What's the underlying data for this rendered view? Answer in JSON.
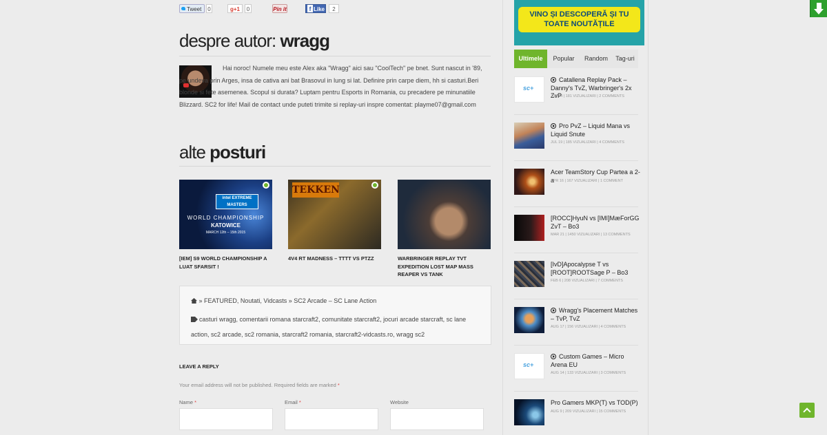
{
  "share": {
    "tweet_label": "Tweet",
    "tweet_count": "0",
    "gplus_label": "g+1",
    "gplus_count": "0",
    "pinit_label": "Pin it",
    "like_label": "Like",
    "like_count": "2"
  },
  "author": {
    "heading_light": "despre autor: ",
    "heading_bold": "wragg",
    "bio": "Hai noroc! Numele meu este Alex aka \"Wragg\" aici sau \"CoolTech\" pe bnet. Sunt nascut in '89, pe undeva prin Arges, insa de cativa ani bat Brasovul in lung si lat. Definire prin carpe diem, hh si casturi.Beri blonde si fete asemenea. Scopul si durata? Luptam pentru Esports in Romania, cu precadere pe minunatiile Blizzard. SC2 for life! Mail de contact unde puteti trimite si replay-uri inspre comentat: playme07@gmail.com"
  },
  "related": {
    "heading_light": "alte ",
    "heading_bold": "posturi",
    "posts": [
      {
        "title": "[IEM] S9 World Championship a luat sfarsit !",
        "thumb_logo": "intel EXTREME MASTERS",
        "thumb_line1": "WORLD CHAMPIONSHIP",
        "thumb_line2": "KATOWICE",
        "thumb_line3": "MARCH 12th – 15th 2015"
      },
      {
        "title": "4v4 RT Madness – TTTT vs PTZZ",
        "thumb_logo": "TEKKEN"
      },
      {
        "title": "Warbringer Replay TvT Expedition Lost Map Mass Reaper vs Tank"
      }
    ]
  },
  "meta": {
    "breadcrumb": "» FEATURED, Noutati, Vidcasts » SC2 Arcade – SC Lane Action",
    "tags": "casturi wragg, comentarii romana starcraft2, comunitate starcraft2, jocuri arcade starcraft, sc lane action, sc2 arcade, sc2 romania, starcraft2 romania, starcraft2-vidcasts.ro, wragg sc2"
  },
  "reply": {
    "title": "Leave a Reply",
    "note": "Your email address will not be published. Required fields are marked",
    "required_mark": "*",
    "name_label": "Name",
    "email_label": "Email",
    "website_label": "Website"
  },
  "sidebar": {
    "banner_text": "VINO ȘI DESCOPERĂ ȘI TU TOATE NOUTĂȚILE",
    "tabs": [
      "Ultimele",
      "Popular",
      "Random",
      "Tag-uri"
    ],
    "items": [
      {
        "title": "Catallena Replay Pack – Danny's TvZ, Warbringer's 2x ZvP",
        "meta": "Jul 24 | 181 vizualizari | 2 comments",
        "video": true
      },
      {
        "title": "Pro PvZ – Liquid Mana vs Liquid Snute",
        "meta": "Jul 19 | 185 vizualizari | 4 comments",
        "video": true
      },
      {
        "title": "Acer TeamStory Cup Partea a 2-a",
        "meta": "Apr 16 | 167 vizualizari | 1 comment",
        "video": false
      },
      {
        "title": "[ROCC]HyuN vs [IMI]MæForGG ZvT – Bo3",
        "meta": "Mar 21 | 1450 vizualizari | 13 comments",
        "video": false
      },
      {
        "title": "[IvD]Apocalypse T vs [ROOT]ROOTSage P – Bo3",
        "meta": "Feb 6 | 208 vizualizari | 7 comments",
        "video": false
      },
      {
        "title": "Wragg's Placement Matches – TvP, TvZ",
        "meta": "Aug 17 | 156 vizualizari | 4 comments",
        "video": true
      },
      {
        "title": "Custom Games – Micro Arena EU",
        "meta": "Aug 14 | 133 vizualizari | 3 comments",
        "video": true
      },
      {
        "title": "Pro Gamers MKP(T) vs TOD(P)",
        "meta": "Aug 9 | 209 vizualizari | 15 comments",
        "video": false
      }
    ]
  },
  "colors": {
    "accent_green": "#6fb52c",
    "banner_teal": "#25a3a8",
    "banner_yellow": "#f3e71a"
  },
  "icons": {
    "download": "download-arrow-icon",
    "scroll_top": "chevron-up-icon",
    "home": "home-icon",
    "tags": "tag-icon",
    "video": "play-circle-icon"
  }
}
